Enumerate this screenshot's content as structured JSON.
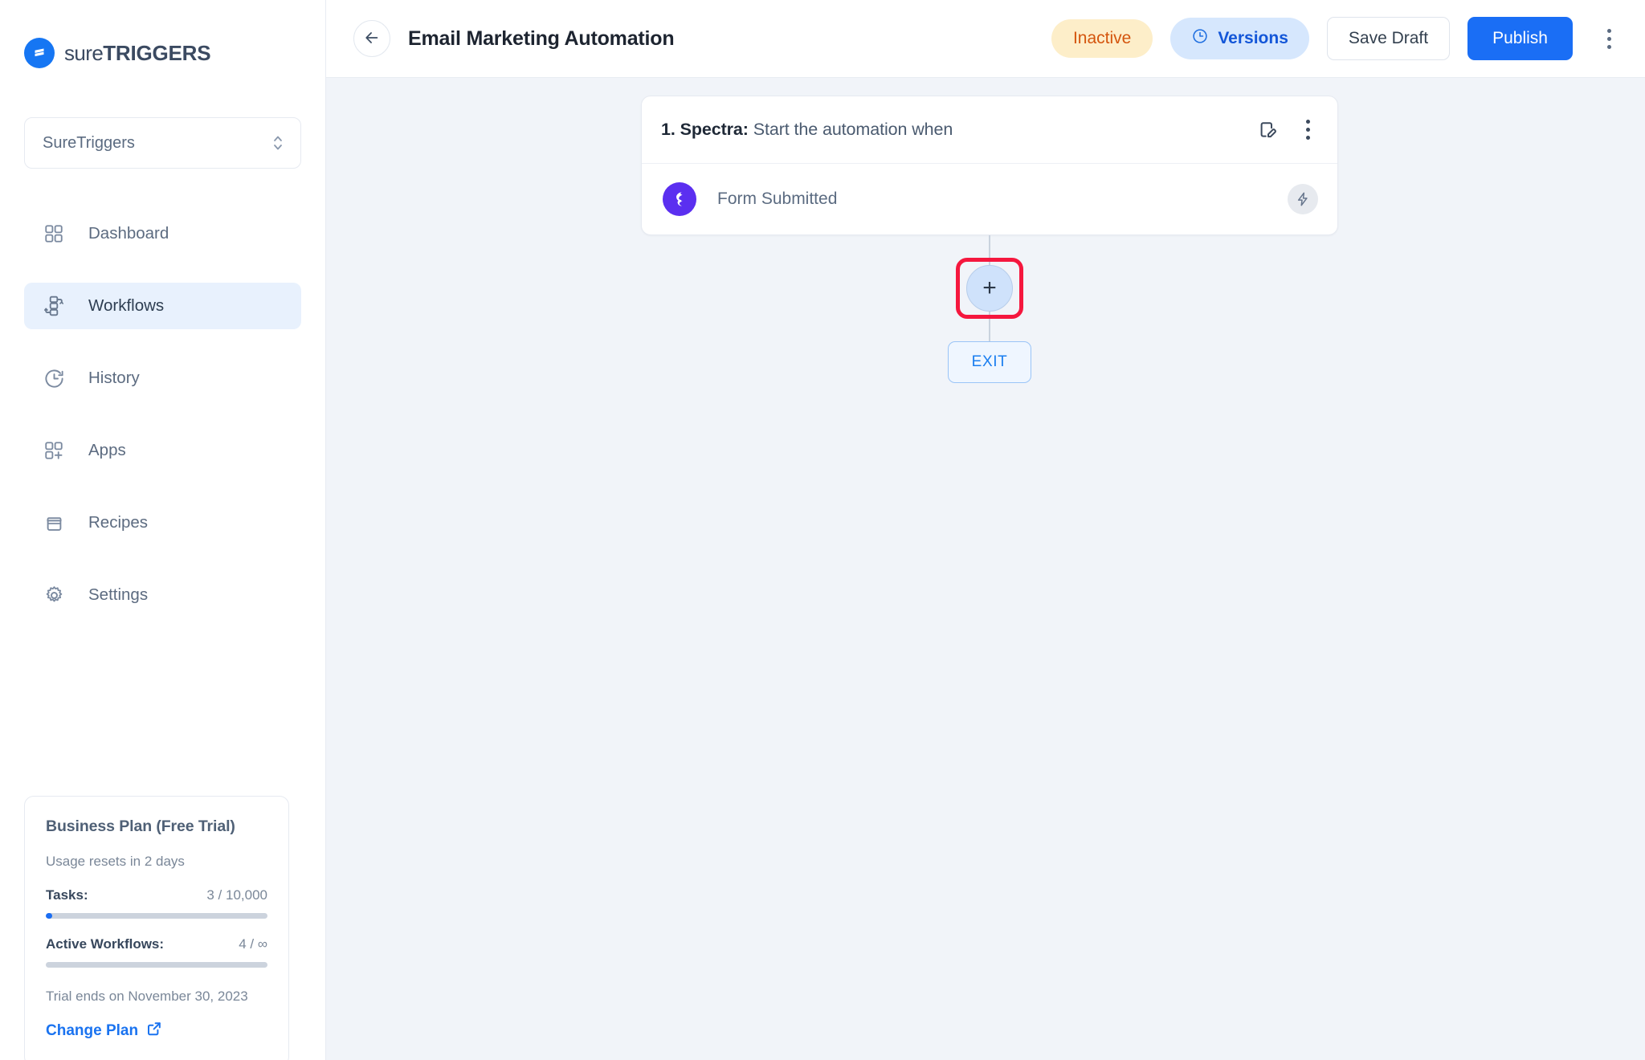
{
  "brand": {
    "logo_light": "sure",
    "logo_bold": "TRIGGERS",
    "logo_icon": "suretriggers-bolt-icon",
    "accent_blue": "#1676F3"
  },
  "sidebar": {
    "workspace": {
      "label": "SureTriggers",
      "chevron_icon": "chevron-up-down-icon"
    },
    "items": [
      {
        "label": "Dashboard",
        "icon": "grid-icon",
        "active": false
      },
      {
        "label": "Workflows",
        "icon": "workflow-icon",
        "active": true
      },
      {
        "label": "History",
        "icon": "clock-history-icon",
        "active": false
      },
      {
        "label": "Apps",
        "icon": "apps-add-icon",
        "active": false
      },
      {
        "label": "Recipes",
        "icon": "recipes-box-icon",
        "active": false
      },
      {
        "label": "Settings",
        "icon": "gear-icon",
        "active": false
      }
    ],
    "plan_card": {
      "title": "Business Plan (Free Trial)",
      "usage_reset": "Usage resets in 2 days",
      "meters": [
        {
          "name": "Tasks:",
          "value": "3 / 10,000",
          "percent": 3
        },
        {
          "name": "Active Workflows:",
          "value": "4 / ∞",
          "percent": 0
        }
      ],
      "trial_note": "Trial ends on November 30, 2023",
      "change_plan": "Change Plan",
      "change_plan_icon": "external-link-icon"
    }
  },
  "header": {
    "back_icon": "arrow-left-icon",
    "title": "Email Marketing Automation",
    "status_badge": "Inactive",
    "status_badge_color": "#d4550d",
    "status_badge_bg": "#fdeec9",
    "versions_label": "Versions",
    "versions_icon": "clock-icon",
    "save_draft_label": "Save Draft",
    "publish_label": "Publish",
    "publish_color": "#1a6ef5",
    "more_menu_icon": "kebab-vertical-icon"
  },
  "canvas": {
    "trigger_card": {
      "step_number_app": "1. Spectra:",
      "step_description": "Start the automation when",
      "edit_icon": "edit-document-icon",
      "menu_icon": "kebab-vertical-icon",
      "app_icon": "spectra-app-icon",
      "app_icon_color": "#5b2ff0",
      "event_label": "Form Submitted",
      "bolt_icon": "lightning-bolt-icon"
    },
    "add_step": {
      "label": "+",
      "icon": "plus-icon",
      "highlight_color": "#f5173e"
    },
    "exit_label": "EXIT",
    "background_color": "#f1f4f9"
  }
}
